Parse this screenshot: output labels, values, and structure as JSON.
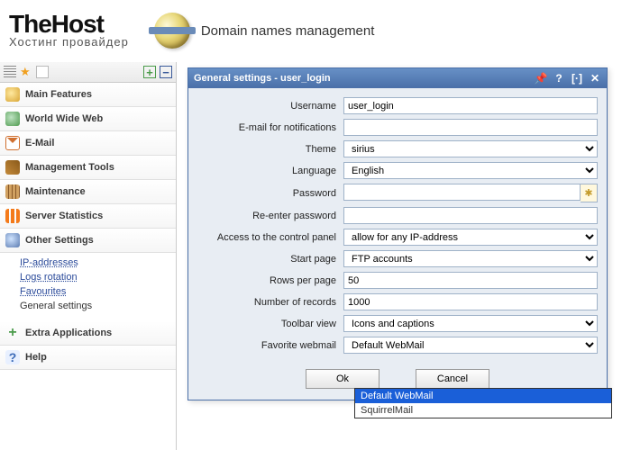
{
  "header": {
    "brand": "TheHost",
    "tagline": "Хостинг провайдер",
    "page_title": "Domain names management"
  },
  "sidebar": {
    "sections": [
      {
        "id": "main",
        "label": "Main Features"
      },
      {
        "id": "www",
        "label": "World Wide Web"
      },
      {
        "id": "mail",
        "label": "E-Mail"
      },
      {
        "id": "tools",
        "label": "Management Tools"
      },
      {
        "id": "maint",
        "label": "Maintenance"
      },
      {
        "id": "stats",
        "label": "Server Statistics"
      },
      {
        "id": "other",
        "label": "Other Settings"
      },
      {
        "id": "extra",
        "label": "Extra Applications"
      },
      {
        "id": "help",
        "label": "Help"
      }
    ],
    "other_children": [
      {
        "label": "IP-addresses"
      },
      {
        "label": "Logs rotation"
      },
      {
        "label": "Favourites"
      },
      {
        "label": "General settings",
        "current": true
      }
    ]
  },
  "dialog": {
    "title": "General settings - user_login",
    "fields": {
      "username": {
        "label": "Username",
        "value": "user_login"
      },
      "email": {
        "label": "E-mail for notifications",
        "value": ""
      },
      "theme": {
        "label": "Theme",
        "value": "sirius"
      },
      "language": {
        "label": "Language",
        "value": "English"
      },
      "password": {
        "label": "Password",
        "value": ""
      },
      "password2": {
        "label": "Re-enter password",
        "value": ""
      },
      "access": {
        "label": "Access to the control panel",
        "value": "allow for any IP-address"
      },
      "startpage": {
        "label": "Start page",
        "value": "FTP accounts"
      },
      "rows": {
        "label": "Rows per page",
        "value": "50"
      },
      "records": {
        "label": "Number of records",
        "value": "1000"
      },
      "toolbar": {
        "label": "Toolbar view",
        "value": "Icons and captions"
      },
      "webmail": {
        "label": "Favorite webmail",
        "value": "Default WebMail",
        "options": [
          "Default WebMail",
          "SquirrelMail"
        ]
      }
    },
    "buttons": {
      "ok": "Ok",
      "cancel": "Cancel"
    }
  }
}
